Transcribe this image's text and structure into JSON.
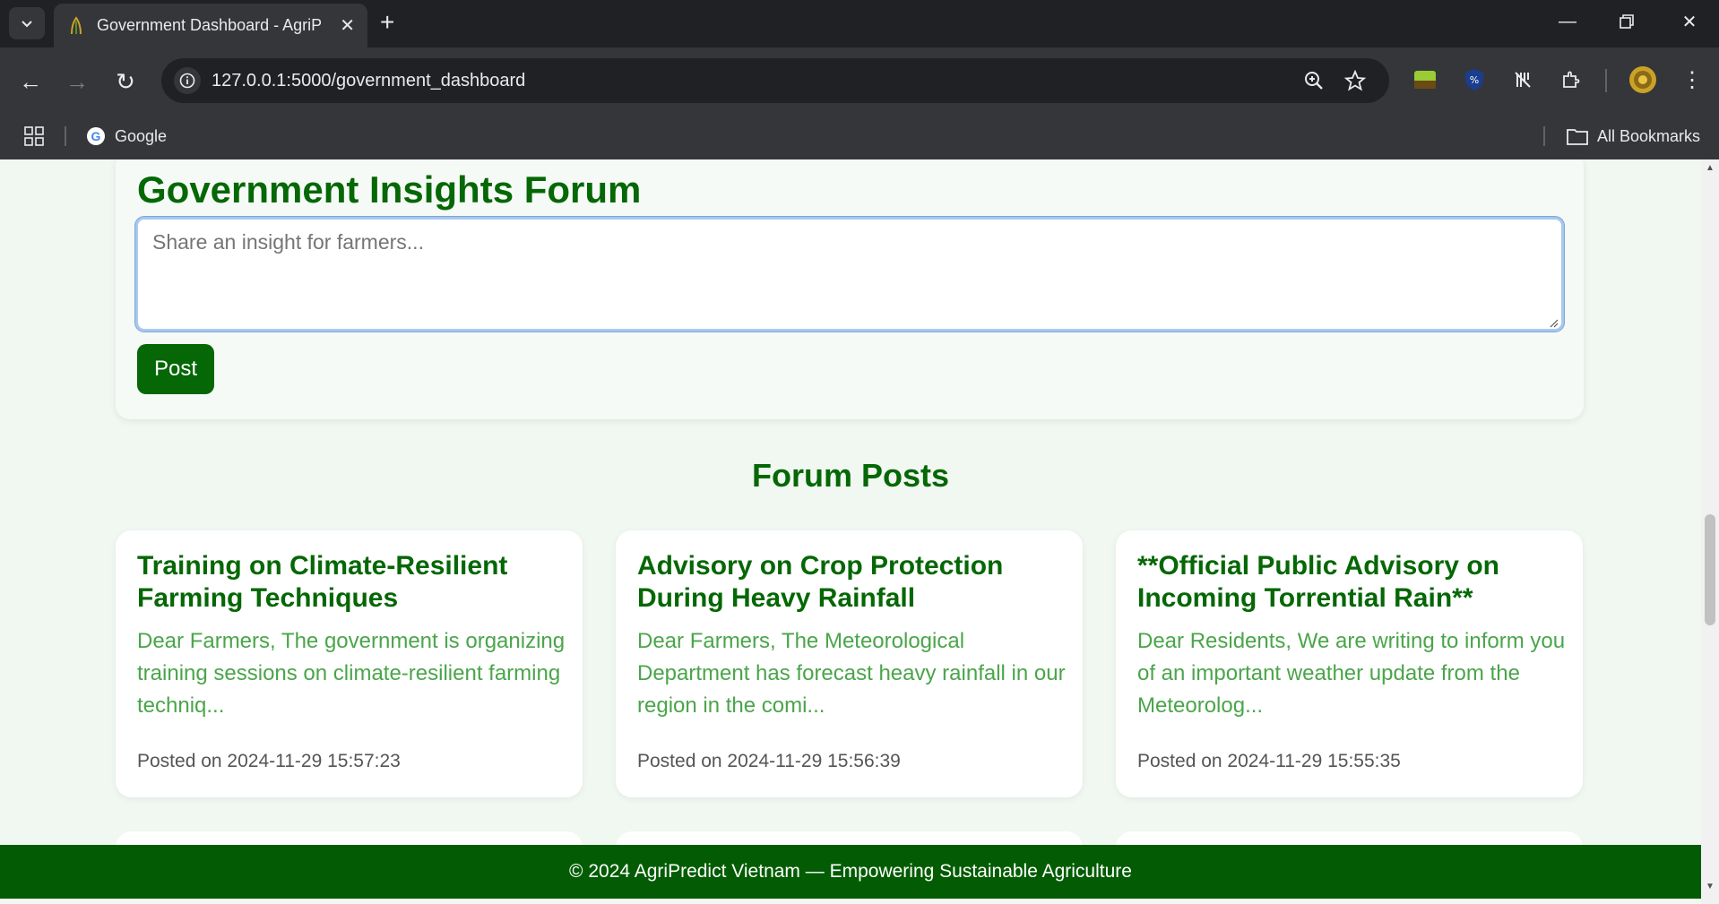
{
  "browser": {
    "tab_title": "Government Dashboard - AgriPredict",
    "url": "127.0.0.1:5000/government_dashboard",
    "bookmarks": [
      {
        "label": "Google"
      }
    ],
    "all_bookmarks_label": "All Bookmarks"
  },
  "forum": {
    "title": "Government Insights Forum",
    "input_placeholder": "Share an insight for farmers...",
    "post_button": "Post"
  },
  "posts_heading": "Forum Posts",
  "posts": [
    {
      "title": "Training on Climate-Resilient Farming Techniques",
      "excerpt": "Dear Farmers, The government is organizing training sessions on climate-resilient farming techniq...",
      "date": "Posted on 2024-11-29 15:57:23"
    },
    {
      "title": "Advisory on Crop Protection During Heavy Rainfall",
      "excerpt": "Dear Farmers, The Meteorological Department has forecast heavy rainfall in our region in the comi...",
      "date": "Posted on 2024-11-29 15:56:39"
    },
    {
      "title": "**Official Public Advisory on Incoming Torrential Rain**",
      "excerpt": "Dear Residents, We are writing to inform you of an important weather update from the Meteorolog...",
      "date": "Posted on 2024-11-29 15:55:35"
    }
  ],
  "footer": "© 2024 AgriPredict Vietnam — Empowering Sustainable Agriculture",
  "colors": {
    "brand_green": "#056705",
    "excerpt_green": "#4aa54a",
    "footer_green": "#035c03",
    "page_bg": "#f1f7f1"
  }
}
